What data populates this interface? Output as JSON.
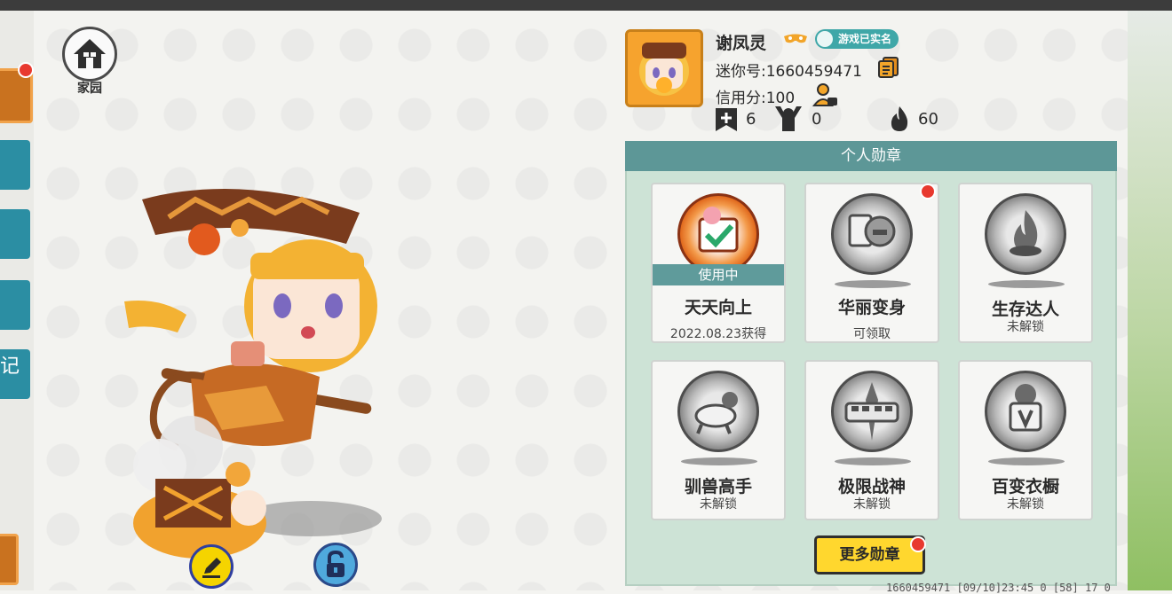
{
  "home": {
    "label": "家园"
  },
  "left_tabs": {
    "partial_label": "记"
  },
  "profile": {
    "name": "谢凤灵",
    "verified_badge": "游戏已实名",
    "mini_id": "迷你号:1660459471",
    "credit": "信用分:100",
    "stats": {
      "plus": "6",
      "cheer": "0",
      "fire": "60"
    }
  },
  "badges": {
    "title": "个人勋章",
    "items": [
      {
        "name": "天天向上",
        "status": "2022.08.23获得",
        "tag": "使用中"
      },
      {
        "name": "华丽变身",
        "status": "可领取"
      },
      {
        "name": "生存达人",
        "status": "未解锁"
      },
      {
        "name": "驯兽高手",
        "status": "未解锁"
      },
      {
        "name": "极限战神",
        "status": "未解锁"
      },
      {
        "name": "百变衣橱",
        "status": "未解锁"
      }
    ],
    "more_button": "更多勋章"
  },
  "footer": {
    "info": "1660459471 [09/10]23:45 0 [58] 17 0"
  },
  "colors": {
    "teal": "#5d9797",
    "panel": "#cde3d6",
    "yellow": "#ffd72e",
    "red_dot": "#e8392f"
  }
}
